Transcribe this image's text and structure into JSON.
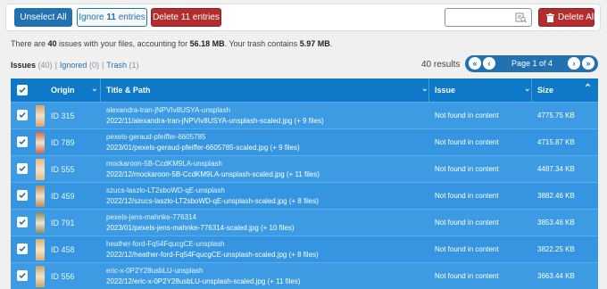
{
  "toolbar": {
    "unselect_label": "Unselect All",
    "ignore_prefix": "Ignore ",
    "ignore_count": "11",
    "ignore_suffix": " entries",
    "delete_entries_label": "Delete 11 entries",
    "search_placeholder": "",
    "delete_all_label": "Delete All"
  },
  "summary": {
    "part1": "There are ",
    "issues": "40",
    "part2": " issues with your files, accounting for ",
    "size": "56.18 MB",
    "part3": ". Your trash contains ",
    "trash": "5.97 MB",
    "part4": "."
  },
  "filters": [
    {
      "label": "Issues",
      "count": "(40)"
    },
    {
      "label": "Ignored",
      "count": "(0)"
    },
    {
      "label": "Trash",
      "count": "(1)"
    }
  ],
  "pagination": {
    "results": "40 results",
    "first": "«",
    "prev": "‹",
    "page": "Page 1 of 4",
    "next": "›",
    "last": "»"
  },
  "table": {
    "headers": {
      "origin": "Origin",
      "title": "Title & Path",
      "issue": "Issue",
      "size": "Size"
    },
    "rows": [
      {
        "id": "ID 315",
        "title": "alexandra-tran-jNPVIv8USYA-unsplash",
        "path": "2022/11/alexandra-tran-jNPVIv8USYA-unsplash-scaled.jpg (+ 9 files)",
        "issue": "Not found in content",
        "size": "4775.75 KB",
        "thumb": "#d9a36b"
      },
      {
        "id": "ID 789",
        "title": "pexels-geraud-pfeiffer-6605785",
        "path": "2023/01/pexels-geraud-pfeiffer-6605785-scaled.jpg (+ 9 files)",
        "issue": "Not found in content",
        "size": "4715.87 KB",
        "thumb": "#c96a4a"
      },
      {
        "id": "ID 555",
        "title": "mockaroon-5B-CcdKM9LA-unsplash",
        "path": "2022/12/mockaroon-5B-CcdKM9LA-unsplash-scaled.jpg (+ 11 files)",
        "issue": "Not found in content",
        "size": "4487.34 KB",
        "thumb": "#e2b98c"
      },
      {
        "id": "ID 459",
        "title": "szucs-laszlo-LT2sboWD-qE-unsplash",
        "path": "2022/12/szucs-laszlo-LT2sboWD-qE-unsplash-scaled.jpg (+ 8 files)",
        "issue": "Not found in content",
        "size": "3882.46 KB",
        "thumb": "#b98a5a"
      },
      {
        "id": "ID 791",
        "title": "pexels-jens-mahnke-776314",
        "path": "2023/01/pexels-jens-mahnke-776314-scaled.jpg (+ 10 files)",
        "issue": "Not found in content",
        "size": "3853.46 KB",
        "thumb": "#7a8f6a"
      },
      {
        "id": "ID 458",
        "title": "heather-ford-Fq54FqucgCE-unsplash",
        "path": "2022/12/heather-ford-Fq54FqucgCE-unsplash-scaled.jpg (+ 8 files)",
        "issue": "Not found in content",
        "size": "3822.25 KB",
        "thumb": "#d6b07a"
      },
      {
        "id": "ID 556",
        "title": "eric-x-0P2Y28usbLU-unsplash",
        "path": "2022/12/eric-x-0P2Y28usbLU-unsplash-scaled.jpg (+ 11 files)",
        "issue": "Not found in content",
        "size": "3663.44 KB",
        "thumb": "#c9a36b"
      }
    ]
  },
  "colors": {
    "accent": "#2271b1",
    "danger": "#b32d2e",
    "header": "#0e79c8",
    "row": "#3d9be4"
  }
}
